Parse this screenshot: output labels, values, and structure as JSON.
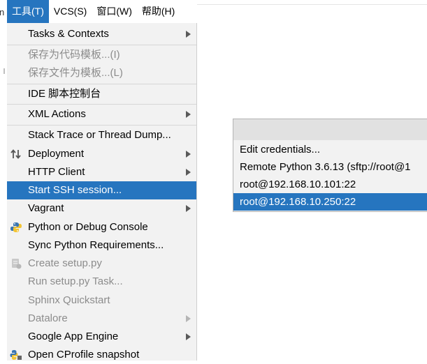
{
  "left_fragment": "n",
  "menubar": {
    "items": [
      {
        "label": "工具(T)",
        "active": true
      },
      {
        "label": "VCS(S)",
        "active": false
      },
      {
        "label": "窗口(W)",
        "active": false
      },
      {
        "label": "帮助(H)",
        "active": false
      }
    ]
  },
  "tools_menu": {
    "items": [
      {
        "label": "Tasks & Contexts",
        "submenu": true
      },
      {
        "label": "保存为代码模板...(I)",
        "disabled": true
      },
      {
        "label": "保存文件为模板...(L)",
        "disabled": true
      },
      {
        "label": "IDE 脚本控制台"
      },
      {
        "label": "XML Actions",
        "submenu": true
      },
      {
        "label": "Stack Trace or Thread Dump..."
      },
      {
        "label": "Deployment",
        "submenu": true,
        "icon": "deployment-icon"
      },
      {
        "label": "HTTP Client",
        "submenu": true
      },
      {
        "label": "Start SSH session...",
        "selected": true
      },
      {
        "label": "Vagrant",
        "submenu": true
      },
      {
        "label": "Python or Debug Console",
        "icon": "python-icon"
      },
      {
        "label": "Sync Python Requirements..."
      },
      {
        "label": "Create setup.py",
        "disabled": true,
        "icon": "setup-py-icon"
      },
      {
        "label": "Run setup.py Task...",
        "disabled": true
      },
      {
        "label": "Sphinx Quickstart",
        "disabled": true
      },
      {
        "label": "Datalore",
        "disabled": true,
        "submenu": true
      },
      {
        "label": "Google App Engine",
        "submenu": true
      },
      {
        "label": "Open CProfile snapshot",
        "icon": "cprofile-icon"
      }
    ]
  },
  "ssh_popup": {
    "items": [
      {
        "label": "Edit credentials..."
      },
      {
        "label": "Remote Python 3.6.13 (sftp://root@1"
      },
      {
        "label": "root@192.168.10.101:22"
      },
      {
        "label": "root@192.168.10.250:22",
        "selected": true
      }
    ]
  },
  "colors": {
    "accent": "#2675bf",
    "menu_bg": "#f2f2f2",
    "disabled_text": "#8c8c8c"
  }
}
